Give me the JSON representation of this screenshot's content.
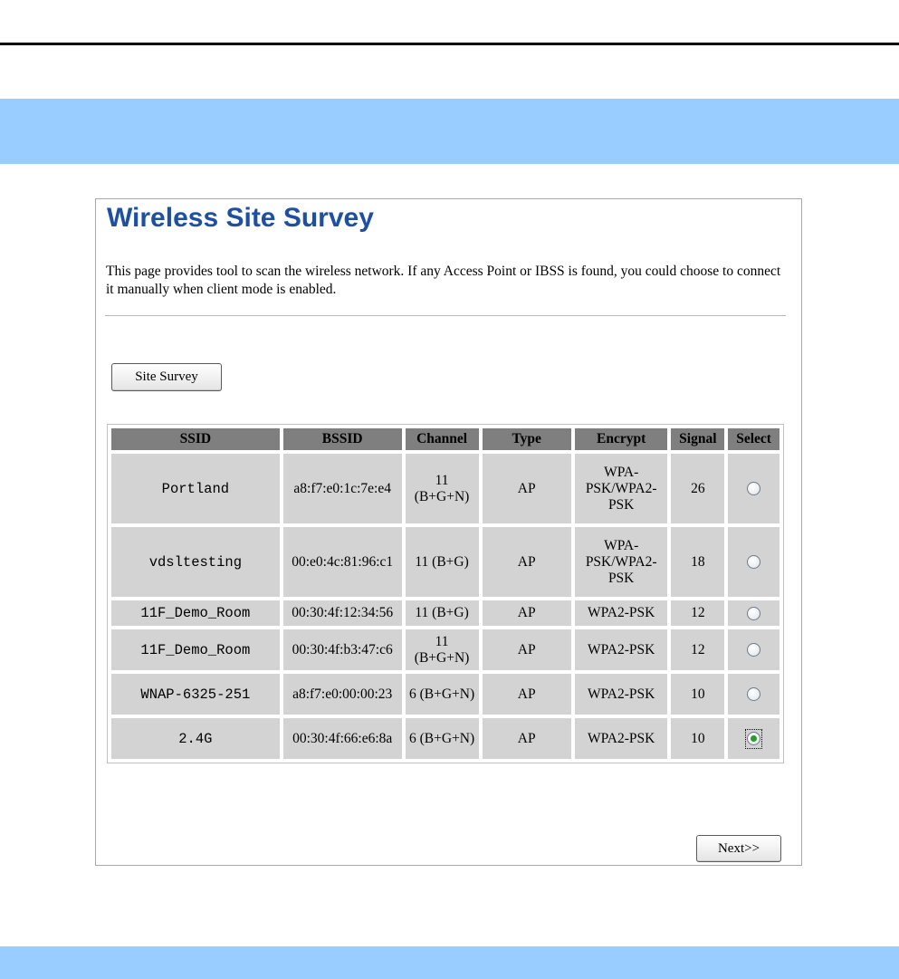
{
  "page": {
    "title": "Wireless Site Survey",
    "description": "This page provides tool to scan the wireless network. If any Access Point or IBSS is found, you could choose to connect it manually when client mode is enabled."
  },
  "buttons": {
    "site_survey": "Site Survey",
    "next": "Next>>"
  },
  "table": {
    "headers": [
      "SSID",
      "BSSID",
      "Channel",
      "Type",
      "Encrypt",
      "Signal",
      "Select"
    ],
    "rows": [
      {
        "ssid": "Portland",
        "bssid": "a8:f7:e0:1c:7e:e4",
        "channel": "11 (B+G+N)",
        "type": "AP",
        "encrypt": "WPA-PSK/WPA2-PSK",
        "signal": "26",
        "selected": false
      },
      {
        "ssid": "vdsltesting",
        "bssid": "00:e0:4c:81:96:c1",
        "channel": "11 (B+G)",
        "type": "AP",
        "encrypt": "WPA-PSK/WPA2-PSK",
        "signal": "18",
        "selected": false
      },
      {
        "ssid": "11F_Demo_Room",
        "bssid": "00:30:4f:12:34:56",
        "channel": "11 (B+G)",
        "type": "AP",
        "encrypt": "WPA2-PSK",
        "signal": "12",
        "selected": false
      },
      {
        "ssid": "11F_Demo_Room",
        "bssid": "00:30:4f:b3:47:c6",
        "channel": "11 (B+G+N)",
        "type": "AP",
        "encrypt": "WPA2-PSK",
        "signal": "12",
        "selected": false
      },
      {
        "ssid": "WNAP-6325-251",
        "bssid": "a8:f7:e0:00:00:23",
        "channel": "6 (B+G+N)",
        "type": "AP",
        "encrypt": "WPA2-PSK",
        "signal": "10",
        "selected": false
      },
      {
        "ssid": "2.4G",
        "bssid": "00:30:4f:66:e6:8a",
        "channel": "6 (B+G+N)",
        "type": "AP",
        "encrypt": "WPA2-PSK",
        "signal": "10",
        "selected": true
      }
    ]
  },
  "colors": {
    "title": "#1d4fa3",
    "band": "#99ccff",
    "header_cell": "#7f7f7f",
    "data_cell": "#d3d3d3",
    "radio_checked": "#2c9a2c"
  }
}
